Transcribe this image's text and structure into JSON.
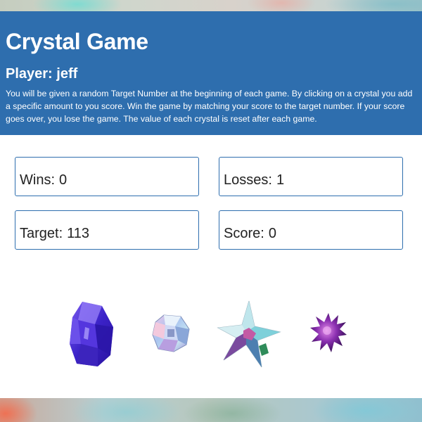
{
  "game": {
    "title": "Crystal Game",
    "player_label": "Player:",
    "player_name": "jeff",
    "instructions": "You will be given a random Target Number at the beginning of each game. By clicking on a crystal you add a specific amount to you score. Win the game by matching your score to the target number. If your score goes over, you lose the game. The value of each crystal is reset after each game."
  },
  "stats": {
    "wins_label": "Wins:",
    "wins": "0",
    "losses_label": "Losses:",
    "losses": "1",
    "target_label": "Target:",
    "target": "113",
    "score_label": "Score:",
    "score": "0"
  },
  "crystals": [
    {
      "name": "purple-crystal",
      "color": "#4a2fd8"
    },
    {
      "name": "iridescent-cube-crystal",
      "color": "#9fb8e8"
    },
    {
      "name": "star-cluster-crystal",
      "color": "#8fd9e0"
    },
    {
      "name": "spiky-purple-crystal",
      "color": "#7a2ea0"
    }
  ],
  "colors": {
    "header_bg": "#2e6eae",
    "box_border": "#2e6eae"
  }
}
